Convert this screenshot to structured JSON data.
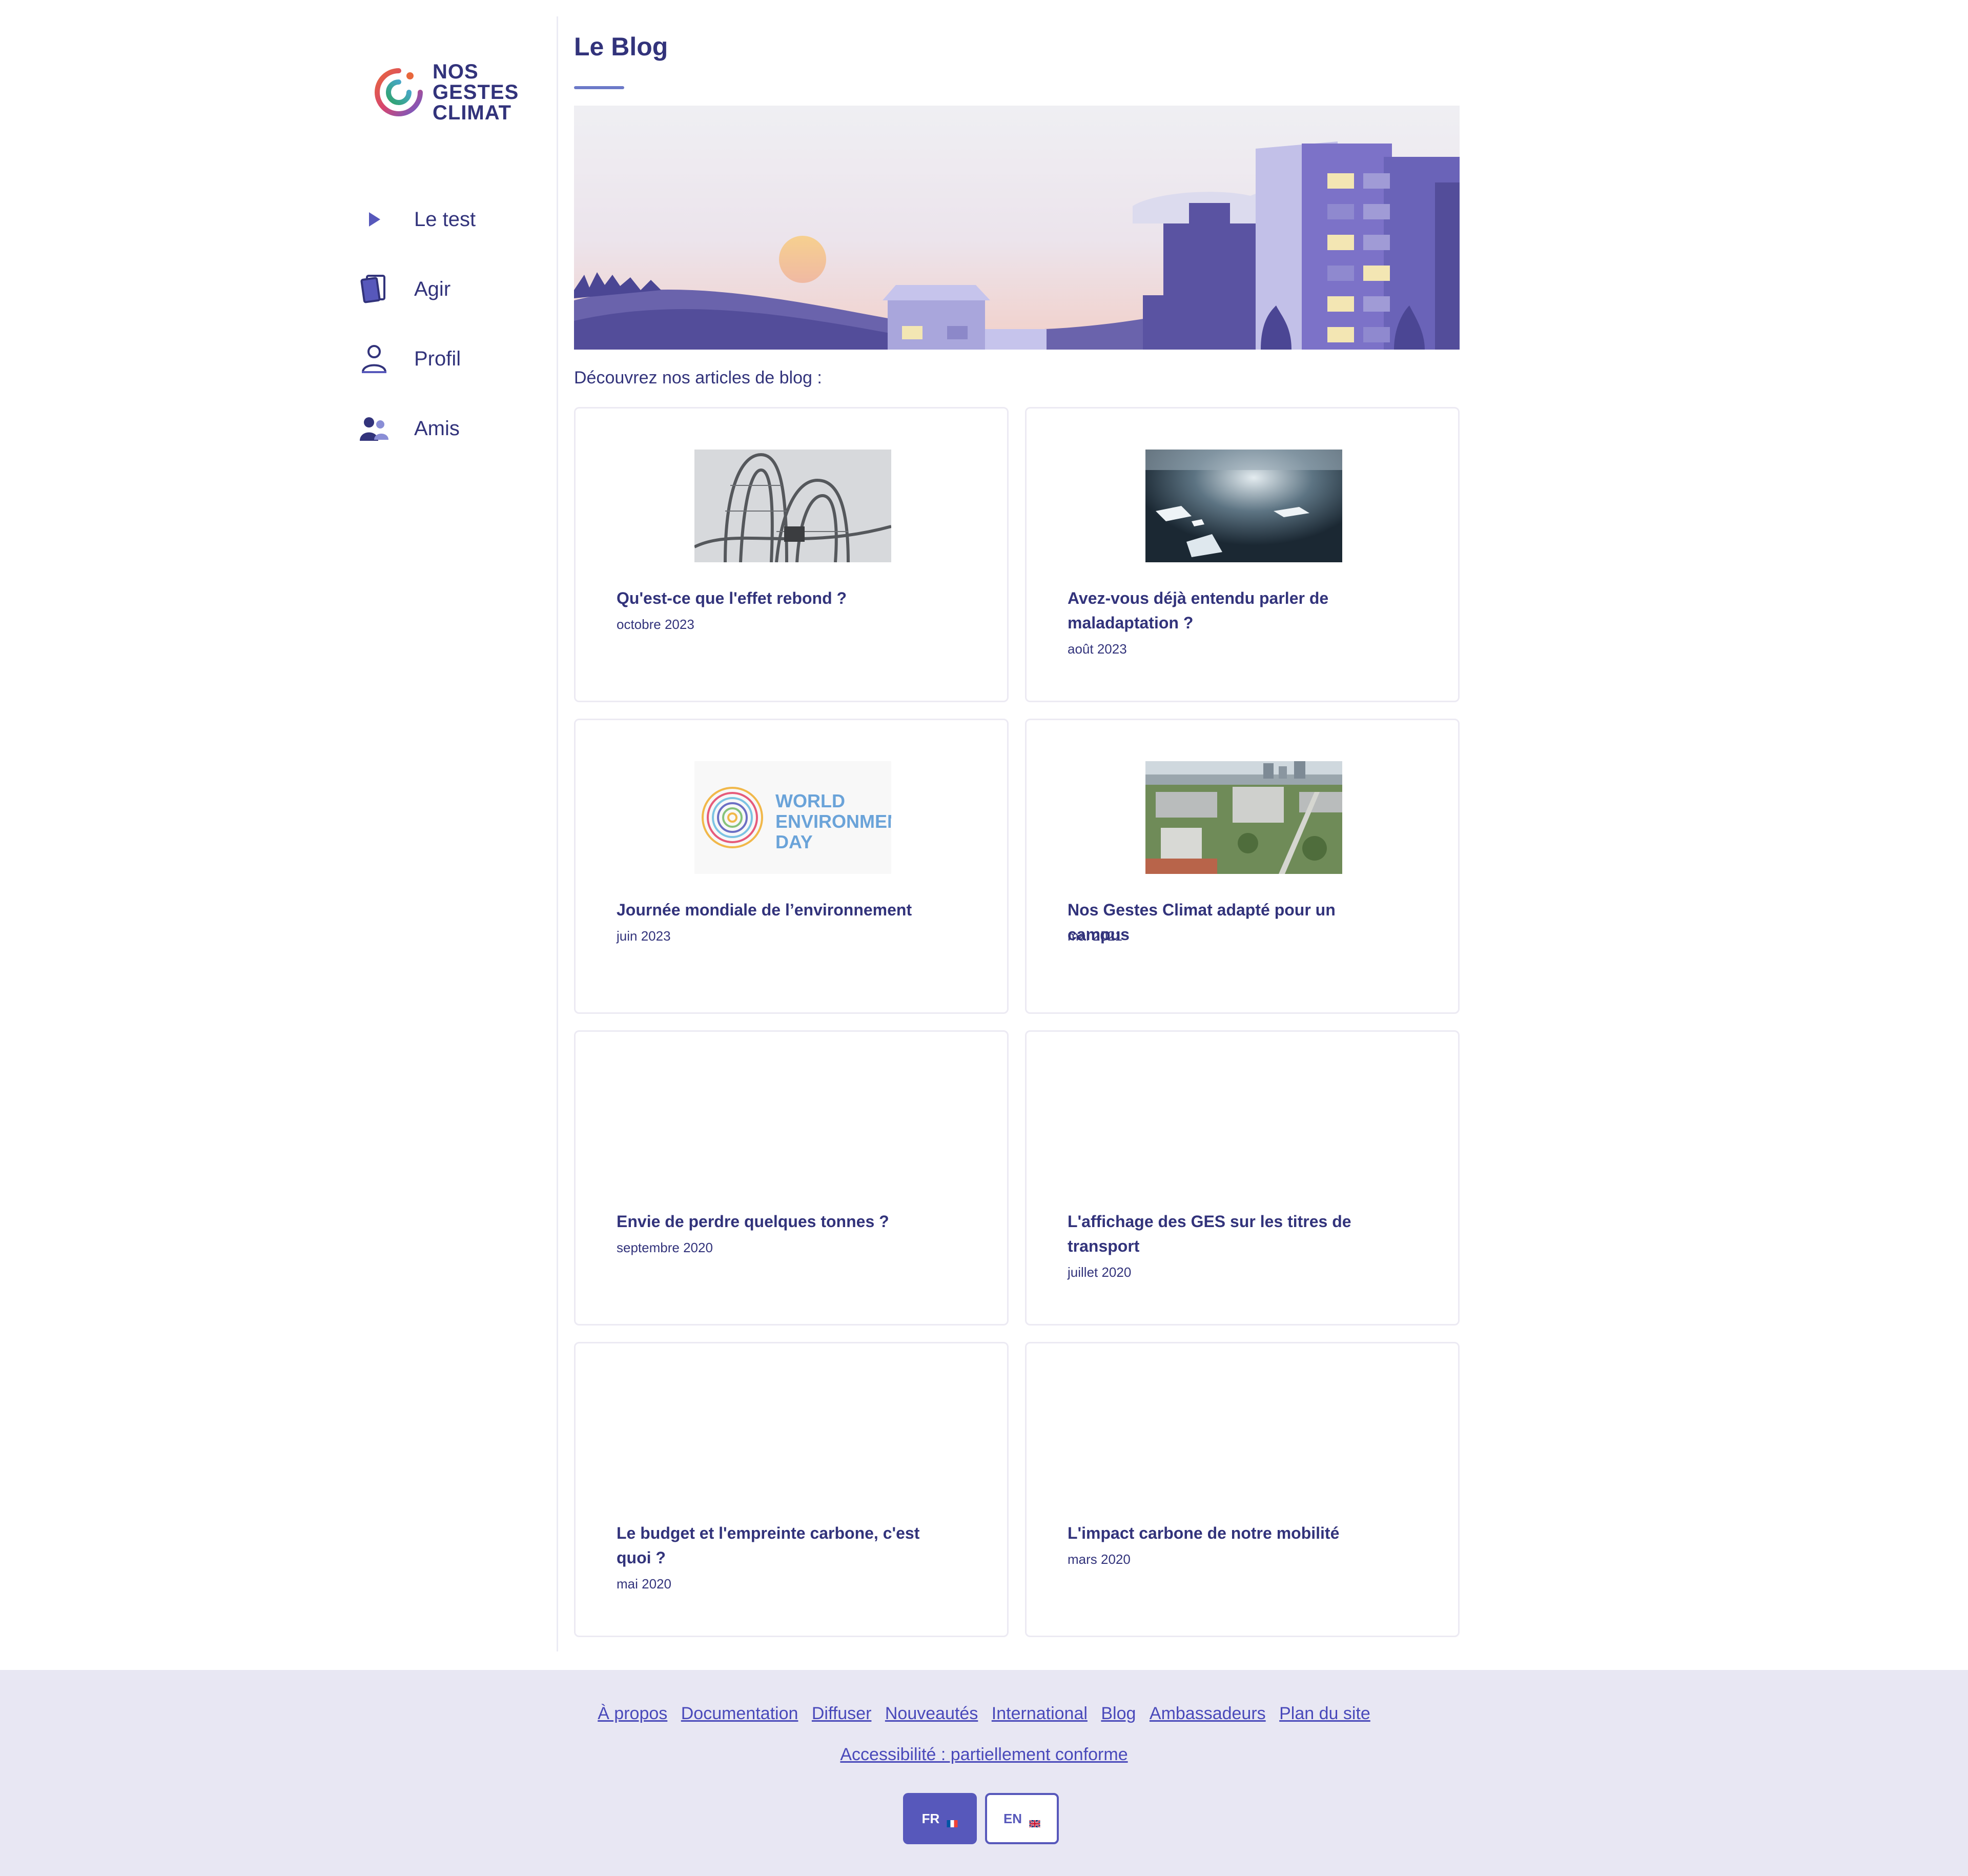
{
  "sidebar": {
    "logo": {
      "line1": "NOS",
      "line2": "GESTES",
      "line3": "CLIMAT"
    },
    "items": [
      {
        "label": "Le test",
        "icon": "play-icon"
      },
      {
        "label": "Agir",
        "icon": "cards-icon"
      },
      {
        "label": "Profil",
        "icon": "user-icon"
      },
      {
        "label": "Amis",
        "icon": "friends-icon"
      }
    ]
  },
  "main": {
    "title": "Le Blog",
    "intro": "Découvrez nos articles de blog :",
    "articles": [
      {
        "title": "Qu'est-ce que l'effet rebond ?",
        "date": "octobre 2023"
      },
      {
        "title": "Avez-vous déjà entendu parler de maladaptation ?",
        "date": "août 2023"
      },
      {
        "title": "Journée mondiale de l’environnement",
        "date": "juin 2023",
        "image_text": "WORLD ENVIRONMENT DAY"
      },
      {
        "title": "Nos Gestes Climat adapté pour un campus",
        "date": "mai 2021"
      },
      {
        "title": "Envie de perdre quelques tonnes ?",
        "date": "septembre 2020"
      },
      {
        "title": "L'affichage des GES sur les titres de transport",
        "date": "juillet 2020"
      },
      {
        "title": "Le budget et l'empreinte carbone, c'est quoi ?",
        "date": "mai 2020"
      },
      {
        "title": "L'impact carbone de notre mobilité",
        "date": "mars 2020"
      }
    ]
  },
  "footer": {
    "links": [
      "À propos",
      "Documentation",
      "Diffuser",
      "Nouveautés",
      "International",
      "Blog",
      "Ambassadeurs",
      "Plan du site"
    ],
    "accessibility": "Accessibilité : partiellement conforme",
    "lang_fr": "FR",
    "lang_en": "EN"
  },
  "colors": {
    "primary": "#32337b",
    "accent": "#5758bb",
    "footer_bg": "#e8e7f3",
    "link": "#4949ba"
  }
}
